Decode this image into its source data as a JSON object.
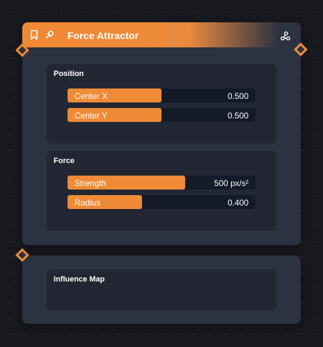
{
  "nodes": {
    "main": {
      "title": "Force Attractor",
      "icons": [
        "bookmark-icon",
        "pin-icon",
        "connect-icon"
      ],
      "sections": {
        "position": {
          "title": "Position",
          "fields": [
            {
              "label": "Center X",
              "value": "0.500",
              "fill": 0.5
            },
            {
              "label": "Center Y",
              "value": "0.500",
              "fill": 0.5
            }
          ]
        },
        "force": {
          "title": "Force",
          "fields": [
            {
              "label": "Strength",
              "value": "500 px/s²",
              "fill": 0.625
            },
            {
              "label": "Radius",
              "value": "0.400",
              "fill": 0.4
            }
          ]
        }
      }
    },
    "influence": {
      "section_title": "Influence Map"
    }
  },
  "colors": {
    "accent": "#ef8b37",
    "background": "#17191f",
    "node": "#2c3241",
    "section": "#222733",
    "field_track": "#141a28"
  }
}
